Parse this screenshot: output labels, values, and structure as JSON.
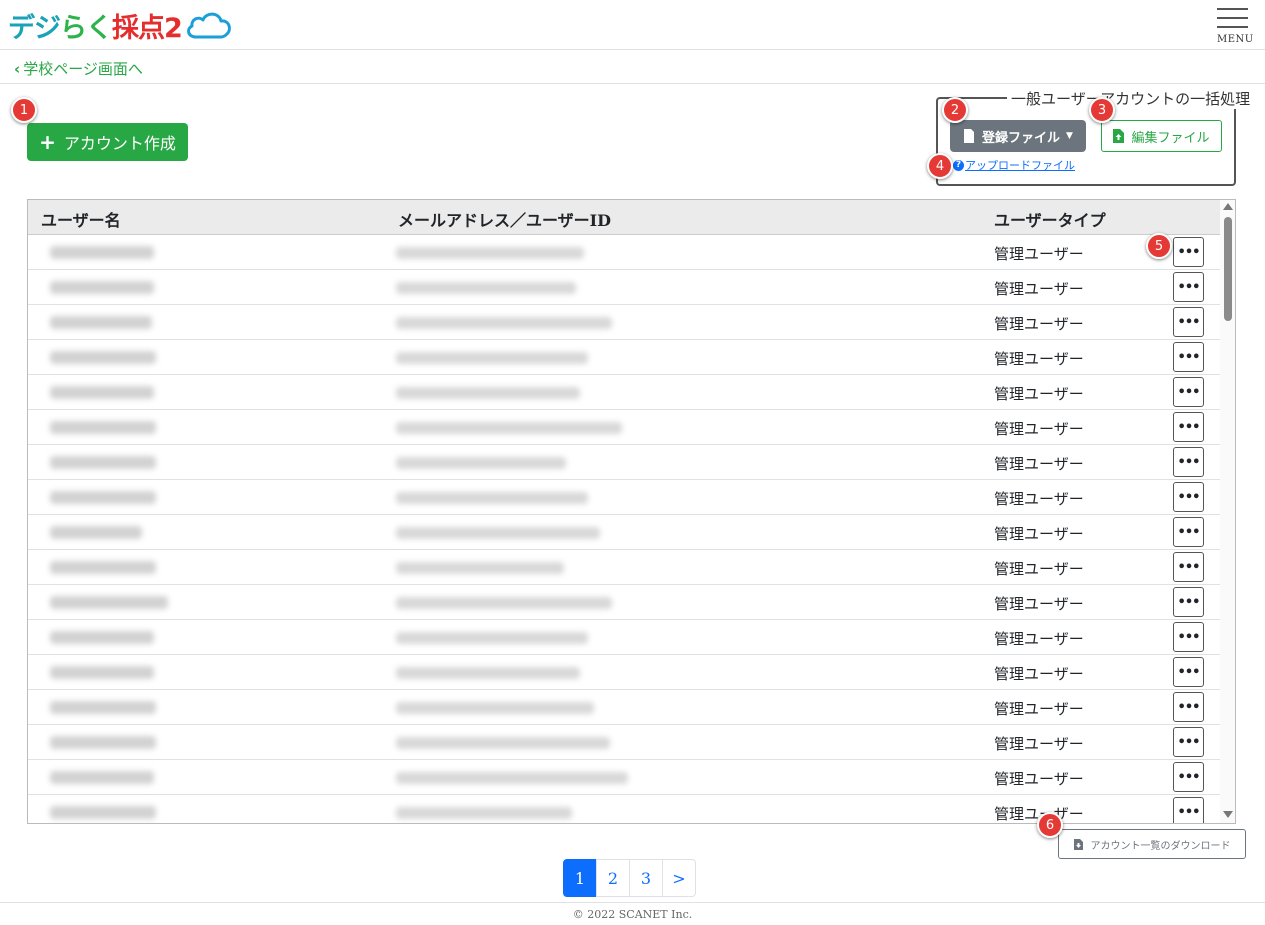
{
  "header": {
    "logo_text": "デジらく採点2",
    "menu_label": "MENU"
  },
  "nav": {
    "back_label": "学校ページ画面へ"
  },
  "actions": {
    "create_label": "アカウント作成",
    "bulk_legend": "一般ユーザーアカウントの一括処理",
    "register_file_label": "登録ファイル",
    "edit_file_label": "編集ファイル",
    "upload_link_label": "アップロードファイル",
    "download_list_label": "アカウント一覧のダウンロード"
  },
  "badges": [
    "1",
    "2",
    "3",
    "4",
    "5",
    "6"
  ],
  "table": {
    "headers": [
      "ユーザー名",
      "メールアドレス／ユーザーID",
      "ユーザータイプ"
    ],
    "rows": [
      {
        "type": "管理ユーザー"
      },
      {
        "type": "管理ユーザー"
      },
      {
        "type": "管理ユーザー"
      },
      {
        "type": "管理ユーザー"
      },
      {
        "type": "管理ユーザー"
      },
      {
        "type": "管理ユーザー"
      },
      {
        "type": "管理ユーザー"
      },
      {
        "type": "管理ユーザー"
      },
      {
        "type": "管理ユーザー"
      },
      {
        "type": "管理ユーザー"
      },
      {
        "type": "管理ユーザー"
      },
      {
        "type": "管理ユーザー"
      },
      {
        "type": "管理ユーザー"
      },
      {
        "type": "管理ユーザー"
      },
      {
        "type": "管理ユーザー"
      },
      {
        "type": "管理ユーザー"
      },
      {
        "type": "管理ユーザー"
      }
    ]
  },
  "pagination": {
    "pages": [
      "1",
      "2",
      "3"
    ],
    "next": ">",
    "current": "1"
  },
  "footer": {
    "copyright": "© 2022 SCANET Inc."
  },
  "colors": {
    "primary_green": "#28a745",
    "secondary_gray": "#6c757d",
    "link_blue": "#0d6efd",
    "badge_red": "#e53935"
  }
}
